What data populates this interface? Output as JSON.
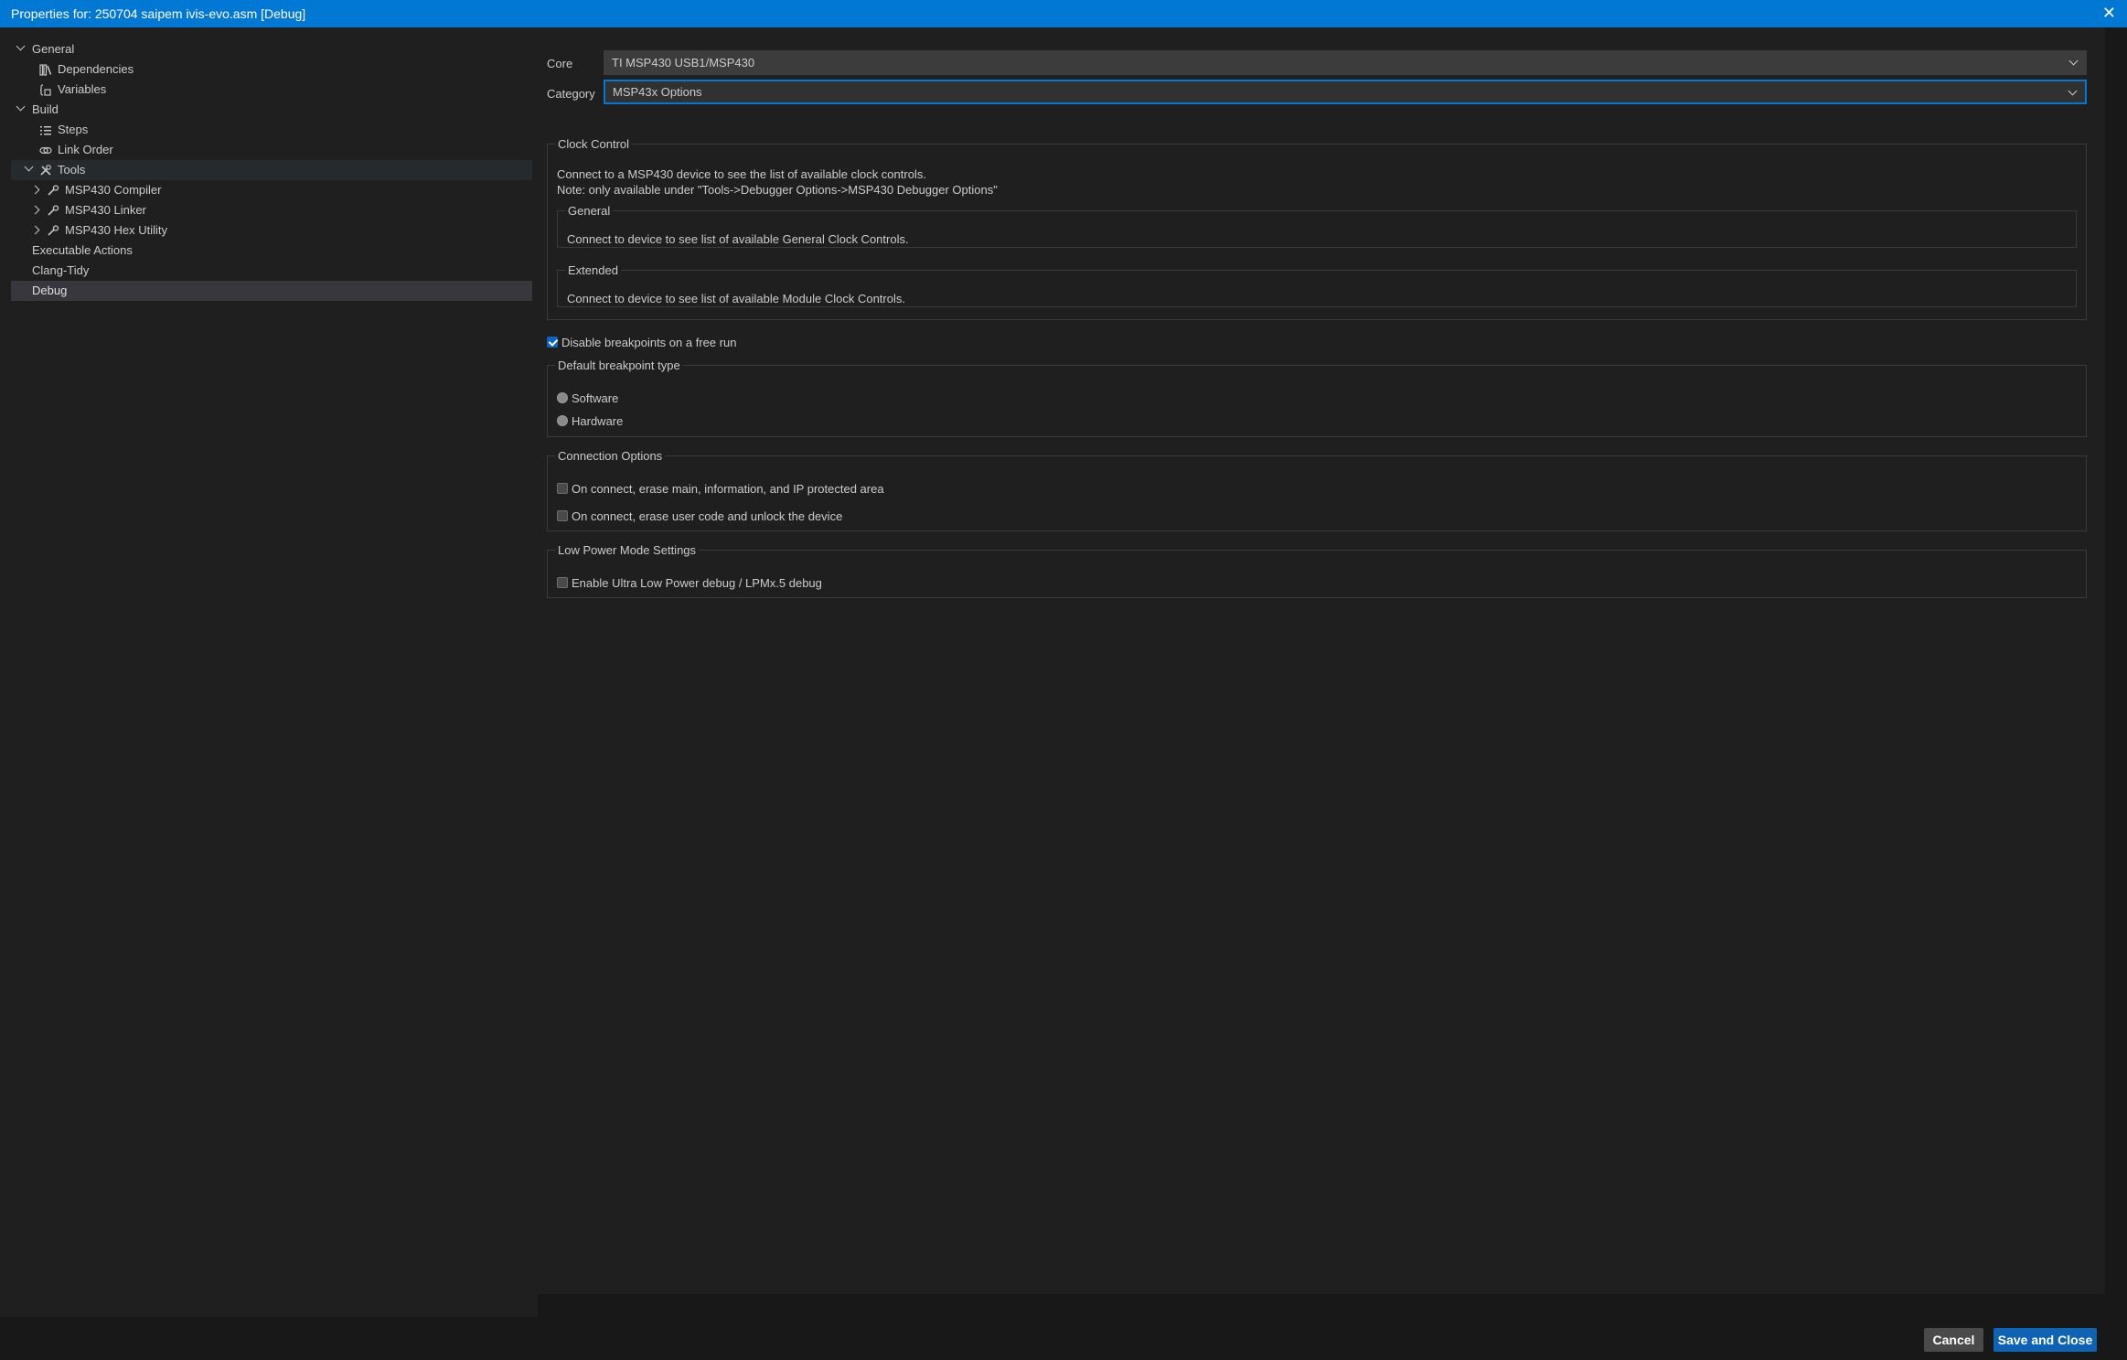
{
  "window": {
    "title": "Properties for: 250704 saipem ivis-evo.asm [Debug]",
    "close_glyph": "✕"
  },
  "tree": {
    "general": "General",
    "dependencies": "Dependencies",
    "variables": "Variables",
    "build": "Build",
    "steps": "Steps",
    "link_order": "Link Order",
    "tools": "Tools",
    "msp430_compiler": "MSP430 Compiler",
    "msp430_linker": "MSP430 Linker",
    "msp430_hex_utility": "MSP430 Hex Utility",
    "executable_actions": "Executable Actions",
    "clang_tidy": "Clang-Tidy",
    "debug": "Debug"
  },
  "form": {
    "core_label": "Core",
    "core_value": "TI MSP430 USB1/MSP430",
    "category_label": "Category",
    "category_value": "MSP43x Options"
  },
  "clock_control": {
    "legend": "Clock Control",
    "line1": "Connect to a MSP430 device to see the list of available clock controls.",
    "line2": "Note: only available under \"Tools->Debugger Options->MSP430 Debugger Options\"",
    "general_legend": "General",
    "general_text": "Connect to device to see list of available General Clock Controls.",
    "extended_legend": "Extended",
    "extended_text": "Connect to device to see list of available Module Clock Controls."
  },
  "disable_breakpoints": {
    "label": "Disable breakpoints on a free run",
    "checked": true
  },
  "breakpoint_type": {
    "legend": "Default breakpoint type",
    "software": "Software",
    "hardware": "Hardware"
  },
  "connection_options": {
    "legend": "Connection Options",
    "erase_main": "On connect, erase main, information, and IP protected area",
    "erase_user": "On connect, erase user code and unlock the device"
  },
  "low_power": {
    "legend": "Low Power Mode Settings",
    "ulp_debug": "Enable Ultra Low Power debug / LPMx.5 debug"
  },
  "footer": {
    "cancel": "Cancel",
    "save": "Save and Close"
  },
  "colors": {
    "accent": "#0078d4",
    "primary_button": "#0e63b4",
    "background": "#1f1f1f"
  }
}
